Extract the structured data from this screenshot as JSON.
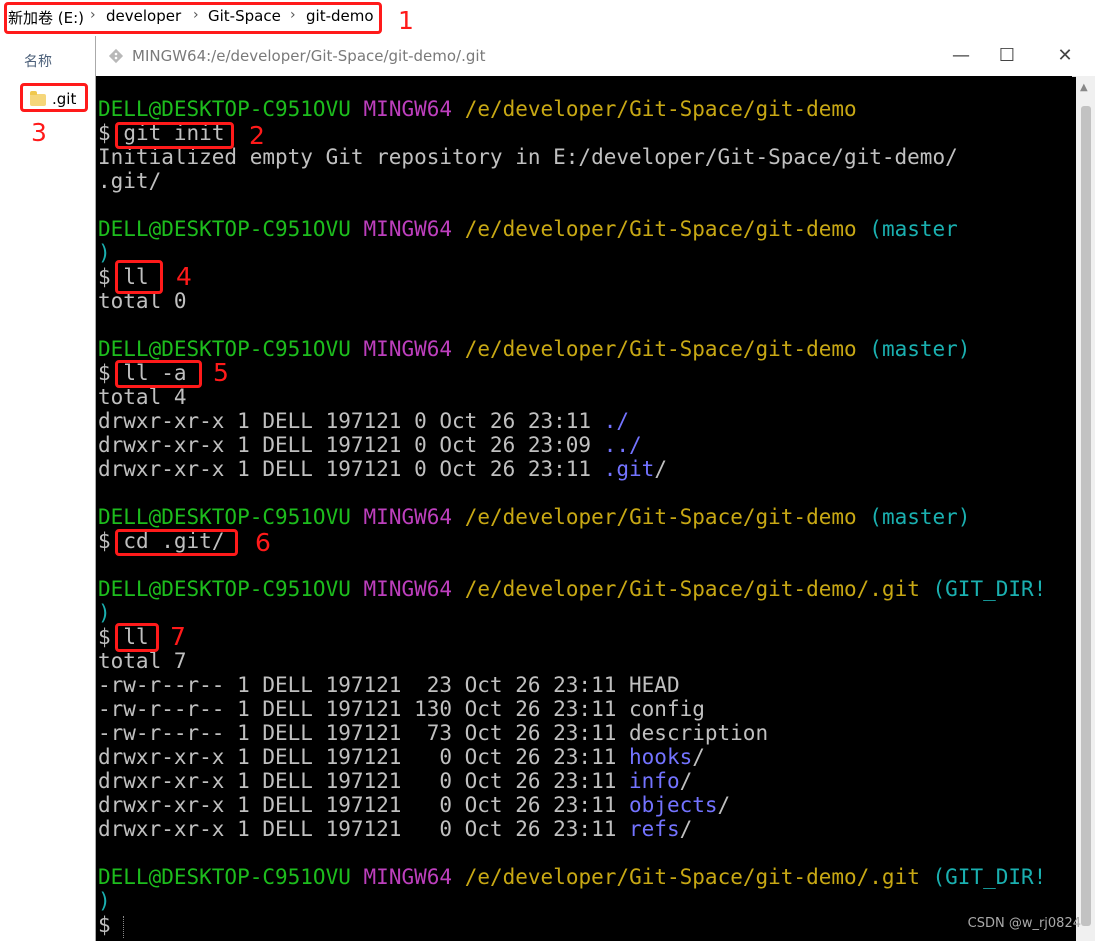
{
  "breadcrumb": {
    "items": [
      "新加卷 (E:)",
      "developer",
      "Git-Space",
      "git-demo"
    ],
    "separator": "›"
  },
  "left_pane": {
    "column_header": "名称",
    "file_item": ".git"
  },
  "window": {
    "title": "MINGW64:/e/developer/Git-Space/git-demo/.git",
    "minimize": "—",
    "maximize": "☐",
    "close": "✕"
  },
  "annotations": [
    "1",
    "2",
    "3",
    "4",
    "5",
    "6",
    "7"
  ],
  "terminal": {
    "user": "DELL@DESKTOP-C951OVU",
    "shell": "MINGW64",
    "path_repo": "/e/developer/Git-Space/git-demo",
    "path_gitdir": "/e/developer/Git-Space/git-demo/.git",
    "branch_master": "(master",
    "branch_master_full": "(master)",
    "branch_gitdir": "(GIT_DIR!",
    "paren_close": ")",
    "prompt": "$",
    "cmd_init": "git init",
    "init_out_1": "Initialized empty Git repository in E:/developer/Git-Space/git-demo/",
    "init_out_2": ".git/",
    "cmd_ll": "ll",
    "total_0": "total 0",
    "cmd_lla": "ll -a",
    "total_4": "total 4",
    "lla_rows": [
      {
        "meta": "drwxr-xr-x 1 DELL 197121 0 Oct 26 23:11 ",
        "name": "./"
      },
      {
        "meta": "drwxr-xr-x 1 DELL 197121 0 Oct 26 23:09 ",
        "name": "../"
      },
      {
        "meta": "drwxr-xr-x 1 DELL 197121 0 Oct 26 23:11 ",
        "name": ".git",
        "suffix": "/"
      }
    ],
    "cmd_cd": "cd .git/",
    "total_7": "total 7",
    "ll_rows": [
      {
        "meta": "-rw-r--r-- 1 DELL 197121  23 Oct 26 23:11 ",
        "name": "HEAD",
        "is_dir": false
      },
      {
        "meta": "-rw-r--r-- 1 DELL 197121 130 Oct 26 23:11 ",
        "name": "config",
        "is_dir": false
      },
      {
        "meta": "-rw-r--r-- 1 DELL 197121  73 Oct 26 23:11 ",
        "name": "description",
        "is_dir": false
      },
      {
        "meta": "drwxr-xr-x 1 DELL 197121   0 Oct 26 23:11 ",
        "name": "hooks",
        "is_dir": true
      },
      {
        "meta": "drwxr-xr-x 1 DELL 197121   0 Oct 26 23:11 ",
        "name": "info",
        "is_dir": true
      },
      {
        "meta": "drwxr-xr-x 1 DELL 197121   0 Oct 26 23:11 ",
        "name": "objects",
        "is_dir": true
      },
      {
        "meta": "drwxr-xr-x 1 DELL 197121   0 Oct 26 23:11 ",
        "name": "refs",
        "is_dir": true
      }
    ],
    "dir_suffix": "/"
  },
  "watermark": "CSDN @w_rj0824",
  "colors": {
    "annotation": "#ff1a1a",
    "user": "#1dbd1d",
    "mingw": "#bd3fbd",
    "path": "#c8a814",
    "branch": "#1ab0b0",
    "directory": "#7373ff"
  }
}
